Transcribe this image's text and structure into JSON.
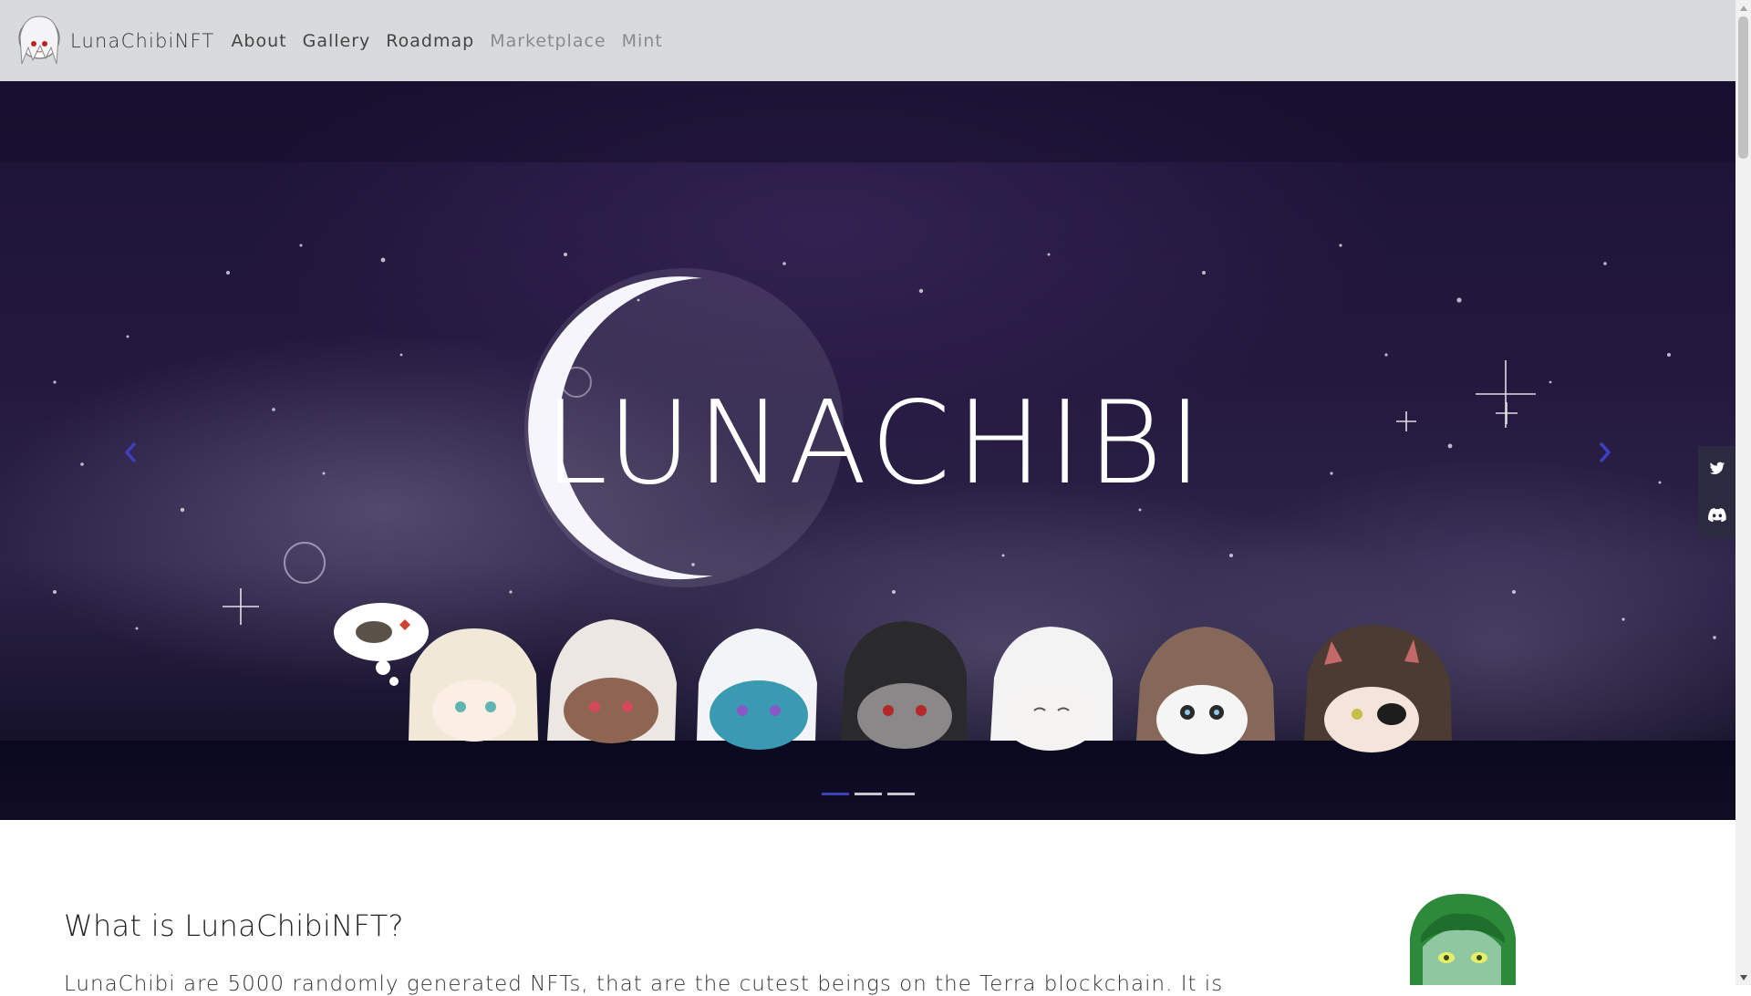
{
  "nav": {
    "brand": "LunaChibiNFT",
    "links": [
      "About",
      "Gallery",
      "Roadmap",
      "Marketplace",
      "Mint"
    ]
  },
  "hero": {
    "logo_text": "LUNACHIBI",
    "slides": 3,
    "active_slide": 1
  },
  "about": {
    "title": "What is LunaChibiNFT?",
    "text": "LunaChibi are 5000 randomly generated NFTs, that are the cutest beings on the Terra blockchain. It is"
  },
  "colors": {
    "navbar": "#d9dadc",
    "accent": "#3e3fb5",
    "hero_dark": "#1c1236",
    "social_bg": "#2c2a40"
  },
  "icons": [
    "twitter-icon",
    "discord-icon",
    "chevron-left-icon",
    "chevron-right-icon"
  ]
}
